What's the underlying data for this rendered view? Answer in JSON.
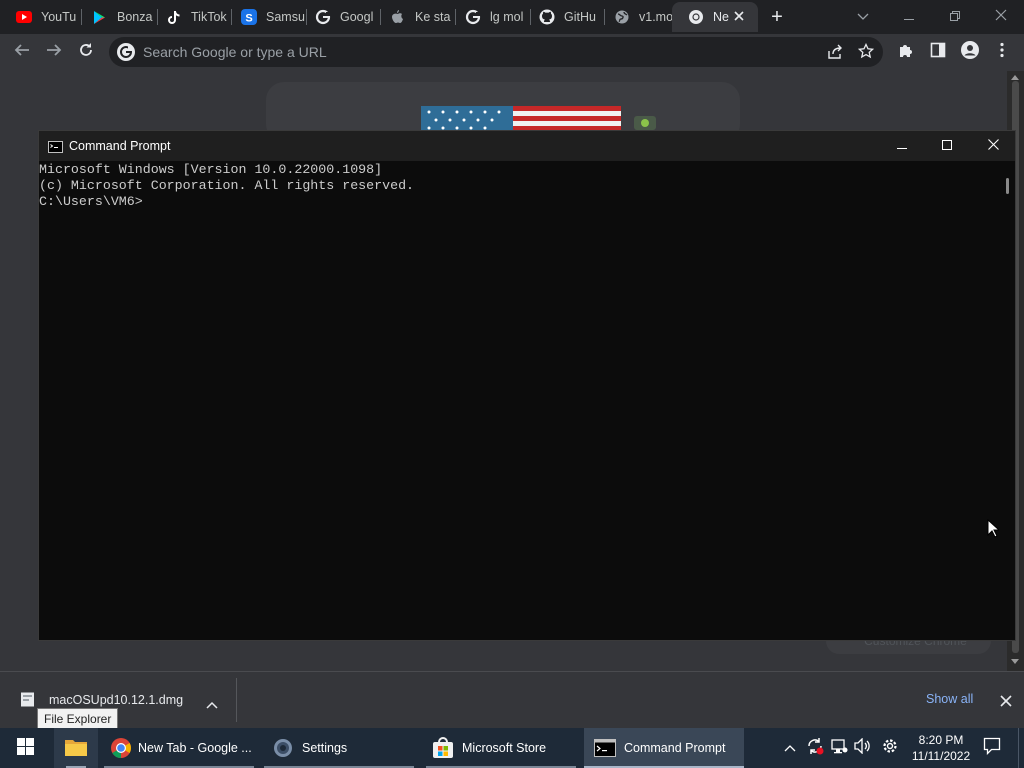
{
  "browser": {
    "tabs": [
      {
        "title": "YouTu",
        "icon": "youtube-icon"
      },
      {
        "title": "Bonza",
        "icon": "google-play-icon"
      },
      {
        "title": "TikTok",
        "icon": "tiktok-icon"
      },
      {
        "title": "Samsu",
        "icon": "samsung-s-icon"
      },
      {
        "title": "Googl",
        "icon": "google-icon"
      },
      {
        "title": "Ke sta",
        "icon": "apple-icon"
      },
      {
        "title": "lg mol",
        "icon": "google-icon"
      },
      {
        "title": "GitHu",
        "icon": "github-icon"
      },
      {
        "title": "v1.mo",
        "icon": "globe-icon"
      },
      {
        "title": "Ne",
        "icon": "chrome-icon"
      }
    ],
    "new_tab_symbol": "+",
    "omnibox_placeholder": "Search Google or type a URL",
    "customize_label": "Customize Chrome"
  },
  "cmd": {
    "title": "Command Prompt",
    "lines": [
      "Microsoft Windows [Version 10.0.22000.1098]",
      "(c) Microsoft Corporation. All rights reserved.",
      "C:\\Users\\VM6>"
    ]
  },
  "downloads": {
    "file_name": "macOSUpd10.12.1.dmg",
    "show_all": "Show all",
    "tooltip": "File Explorer"
  },
  "taskbar": {
    "items": [
      {
        "label": "New Tab - Google ...",
        "icon": "chrome-icon"
      },
      {
        "label": "Settings",
        "icon": "settings-gear-icon"
      },
      {
        "label": "Microsoft Store",
        "icon": "store-icon"
      },
      {
        "label": "Command Prompt",
        "icon": "cmd-icon"
      }
    ],
    "time": "8:20 PM",
    "date": "11/11/2022"
  },
  "colors": {
    "chrome_dark": "#202124",
    "chrome_toolbar": "#35363a",
    "cmd_background": "#0c0c0c",
    "taskbar": "#1e2a38",
    "link_blue": "#8ab4f8"
  }
}
